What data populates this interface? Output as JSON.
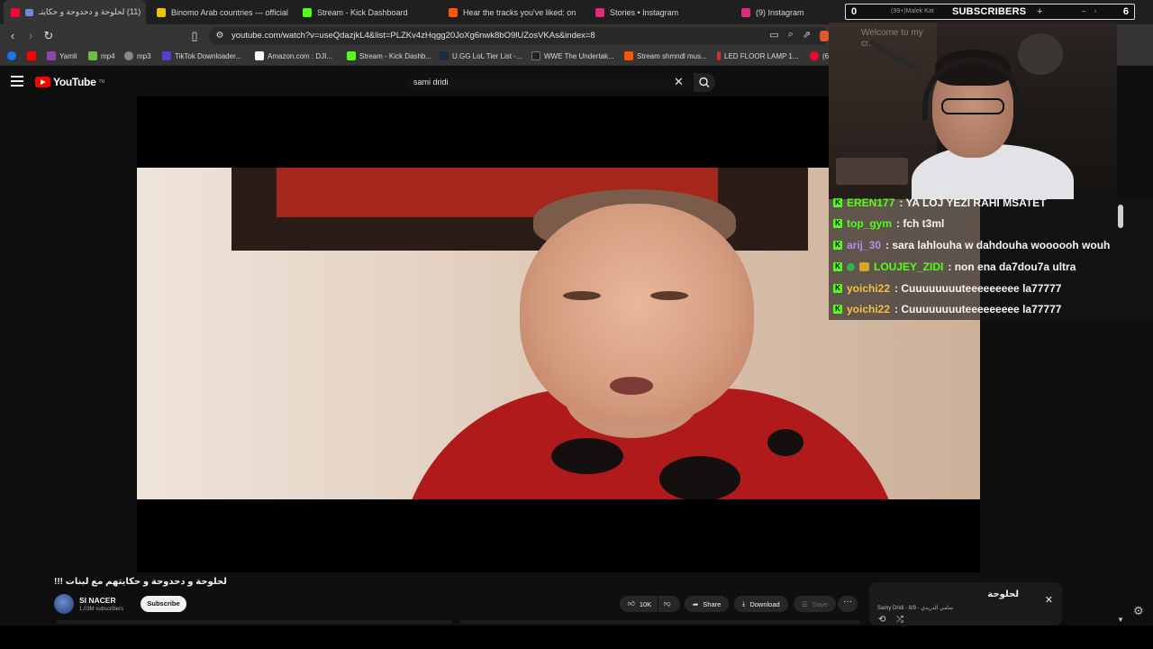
{
  "browser": {
    "tabs": [
      {
        "label": "(11) لحلوحة و دحدوحة و حكايتـ",
        "color": "#ff0033",
        "active": true
      },
      {
        "label": "Binomo Arab countries — official site",
        "color": "#f2c200",
        "active": false
      },
      {
        "label": "Stream - Kick Dashboard",
        "color": "#53fc18",
        "active": false
      },
      {
        "label": "Hear the tracks you've liked: on SoundCloud",
        "color": "#ff5500",
        "active": false
      },
      {
        "label": "Stories • Instagram",
        "color": "#dd2a7b",
        "active": false
      },
      {
        "label": "(9) Instagram",
        "color": "#dd2a7b",
        "active": false
      }
    ],
    "tab_close": "×",
    "url": "youtube.com/watch?v=useQdazjkL4&list=PLZKv4zHqgg20JoXg6nwk8bO9lUZosVKAs&index=8",
    "bookmarks": [
      {
        "label": "",
        "color": "#1877f2"
      },
      {
        "label": "",
        "color": "#ff0000"
      },
      {
        "label": "Yamli",
        "color": "#8e44ad"
      },
      {
        "label": "mp4",
        "color": "#6abf3c"
      },
      {
        "label": "mp3",
        "color": "#888888"
      },
      {
        "label": "TikTok Downloader...",
        "color": "#5b3bd6"
      },
      {
        "label": "Amazon.com : DJI...",
        "color": "#ffffff"
      },
      {
        "label": "Stream - Kick Dashb...",
        "color": "#53fc18"
      },
      {
        "label": "U.GG LoL Tier List -...",
        "color": "#1e2a44"
      },
      {
        "label": "WWE The Undertak...",
        "color": "#222222"
      },
      {
        "label": "Stream shmndl mus...",
        "color": "#ff5500"
      },
      {
        "label": "LED FLOOR LAMP 1...",
        "color": "#cc3333"
      },
      {
        "label": "(6",
        "color": "#ff0033"
      }
    ]
  },
  "youtube": {
    "logo_text": "YouTube",
    "logo_sup": "TN",
    "search_value": "sami dridi",
    "video_title": "لحلوحة و دحدوحة و حكايتهم مع لبنات !!!",
    "channel_name": "SI NACER",
    "channel_subs": "1.03M subscribers",
    "subscribe_label": "Subscribe",
    "like_count": "10K",
    "share_label": "Share",
    "download_label": "Download",
    "save_label": "Save",
    "more_label": "···",
    "playlist": {
      "title": "لحلوحة",
      "subtitle": "Samy Dridi - سامي الدريدي - 8/9",
      "close": "✕"
    }
  },
  "stream_overlay": {
    "sub_current": "0",
    "sub_small": "(99+)Malek Kat",
    "sub_label": "SUBSCRIBERS",
    "sub_goal": "6",
    "cam_text": "Welcome to my crib",
    "chat": [
      {
        "user": "EREN177",
        "color": "#53fc18",
        "message": ": YA LOJ YEZI RAHI MSATET",
        "badges": []
      },
      {
        "user": "top_gym",
        "color": "#53fc18",
        "message": ": fch t3ml",
        "badges": []
      },
      {
        "user": "arij_30",
        "color": "#b48cf0",
        "message": ": sara lahlouha w dahdouha woooooh wouh",
        "badges": []
      },
      {
        "user": "LOUJEY_ZIDI",
        "color": "#53fc18",
        "message": ": non ena da7dou7a ultra",
        "badges": [
          "verified",
          "sub"
        ]
      },
      {
        "user": "yoichi22",
        "color": "#f0c04a",
        "message": ": Cuuuuuuuuteeeeeeeee la77777",
        "badges": []
      },
      {
        "user": "yoichi22",
        "color": "#f0c04a",
        "message": ": Cuuuuuuuuteeeeeeeee la77777",
        "badges": []
      }
    ]
  },
  "colors": {
    "yt_red": "#ff0000",
    "kick_green": "#53fc18",
    "page_bg": "#0f0f0f"
  }
}
